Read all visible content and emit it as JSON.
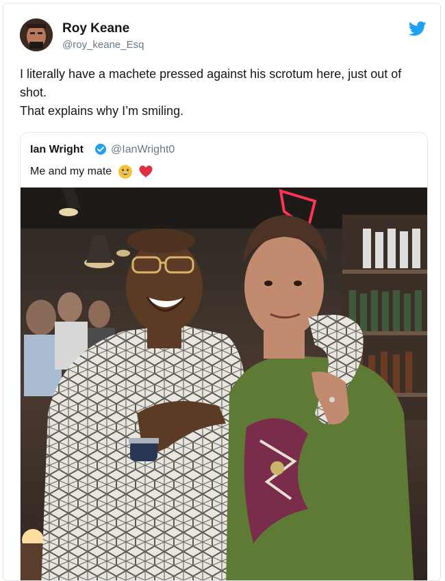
{
  "tweet": {
    "author_name": "Roy Keane",
    "author_handle": "@roy_keane_Esq",
    "text_line1": "I literally have a machete pressed against his scrotum here, just out of shot.",
    "text_line2": "That explains why I’m smiling."
  },
  "quoted": {
    "author_name": "Ian Wright",
    "author_handle": "@IanWright0",
    "text": "Me and my mate",
    "emojis": [
      "grinning-face",
      "red-heart"
    ]
  },
  "colors": {
    "twitter_blue": "#1da1f2",
    "handle_grey": "#657786",
    "border": "#e1e8ed"
  },
  "icons": {
    "brand": "twitter-bird-icon",
    "verified": "verified-badge-icon"
  }
}
